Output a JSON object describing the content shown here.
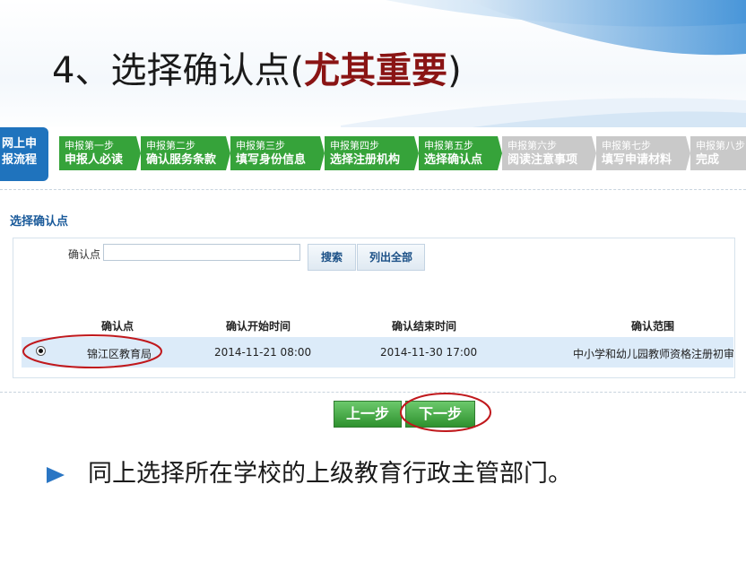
{
  "slide": {
    "title_prefix": "4、选择确认点(",
    "title_highlight": "尤其重要",
    "title_suffix": ")"
  },
  "stepper": {
    "lead": [
      "网上申",
      "报流程"
    ],
    "steps": [
      {
        "line1": "申报第一步",
        "line2": "申报人必读",
        "state": "done"
      },
      {
        "line1": "申报第二步",
        "line2": "确认服务条款",
        "state": "done"
      },
      {
        "line1": "申报第三步",
        "line2": "填写身份信息",
        "state": "done"
      },
      {
        "line1": "申报第四步",
        "line2": "选择注册机构",
        "state": "done"
      },
      {
        "line1": "申报第五步",
        "line2": "选择确认点",
        "state": "done"
      },
      {
        "line1": "申报第六步",
        "line2": "阅读注意事项",
        "state": "todo"
      },
      {
        "line1": "申报第七步",
        "line2": "填写申请材料",
        "state": "todo"
      },
      {
        "line1": "申报第八步",
        "line2": "完成",
        "state": "todo"
      }
    ]
  },
  "form": {
    "section_title": "选择确认点",
    "field_label": "确认点",
    "field_value": "",
    "search_button": "搜索",
    "list_all_button": "列出全部"
  },
  "table": {
    "headers": [
      "确认点",
      "确认开始时间",
      "确认结束时间",
      "确认范围"
    ],
    "rows": [
      {
        "name": "锦江区教育局",
        "start": "2014-11-21 08:00",
        "end": "2014-11-30 17:00",
        "scope": "中小学和幼儿园教师资格注册初审"
      }
    ]
  },
  "nav": {
    "prev": "上一步",
    "next": "下一步"
  },
  "bullet": {
    "text": "同上选择所在学校的上级教育行政主管部门。"
  },
  "colors": {
    "title_highlight": "#8a1414",
    "step_done": "#36a33a",
    "step_todo": "#c9c9c9",
    "lead_blue": "#1f73bd",
    "annotation_red": "#c0181c",
    "bullet_arrow": "#2a76c4"
  }
}
